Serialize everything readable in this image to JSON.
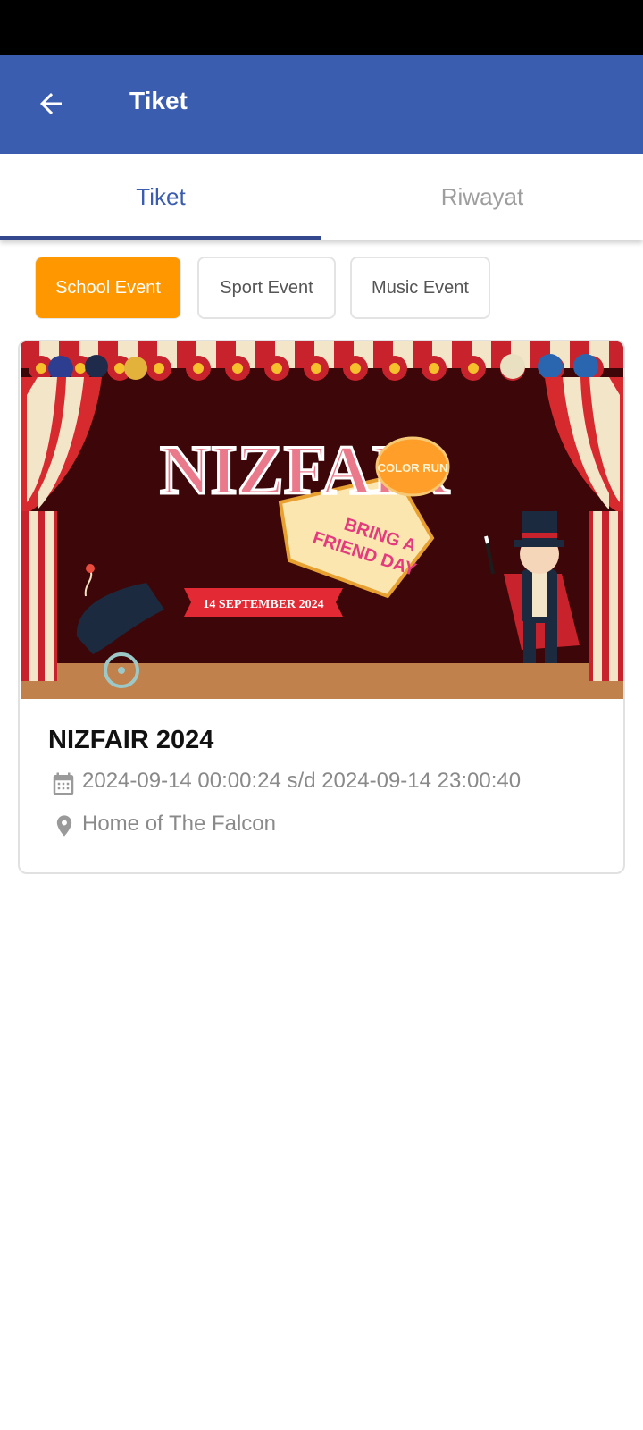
{
  "appbar": {
    "title": "Tiket",
    "back_icon": "arrow-left-icon"
  },
  "tabs": [
    {
      "label": "Tiket",
      "active": true
    },
    {
      "label": "Riwayat",
      "active": false
    }
  ],
  "categories": [
    {
      "label": "School Event",
      "selected": true
    },
    {
      "label": "Sport Event",
      "selected": false
    },
    {
      "label": "Music Event",
      "selected": false
    }
  ],
  "event": {
    "banner": {
      "title": "NIZFAIR",
      "badge": "COLOR RUN",
      "tagline_line1": "BRING A",
      "tagline_line2": "FRIEND DAY",
      "date_ribbon": "14 SEPTEMBER 2024"
    },
    "name": "NIZFAIR 2024",
    "datetime": "2024-09-14 00:00:24 s/d 2024-09-14 23:00:40",
    "location": "Home of The Falcon"
  },
  "colors": {
    "primary": "#3a5daf",
    "accent": "#ff9800",
    "tab_indicator": "#34488d"
  }
}
